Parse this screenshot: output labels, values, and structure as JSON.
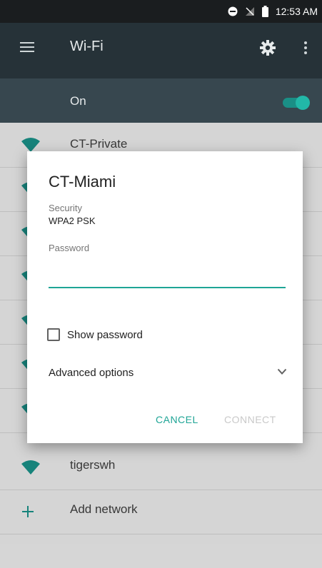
{
  "status_bar": {
    "time": "12:53 AM"
  },
  "toolbar": {
    "title": "Wi-Fi",
    "icons": [
      "menu-icon",
      "gear-icon",
      "overflow-icon"
    ]
  },
  "wifi_toggle": {
    "label": "On",
    "state": true,
    "accent": "#22b8a8"
  },
  "networks": [
    {
      "name": "CT-Private"
    },
    {
      "name": ""
    },
    {
      "name": ""
    },
    {
      "name": ""
    },
    {
      "name": ""
    },
    {
      "name": ""
    },
    {
      "name": ""
    },
    {
      "name": "tigerswh"
    }
  ],
  "add_network": {
    "label": "Add network"
  },
  "dialog": {
    "title": "CT-Miami",
    "security_label": "Security",
    "security_value": "WPA2 PSK",
    "password_label": "Password",
    "password_value": "",
    "show_password_label": "Show password",
    "show_password_checked": false,
    "advanced_label": "Advanced options",
    "cancel_label": "CANCEL",
    "connect_label": "CONNECT",
    "accent": "#1fa596"
  }
}
